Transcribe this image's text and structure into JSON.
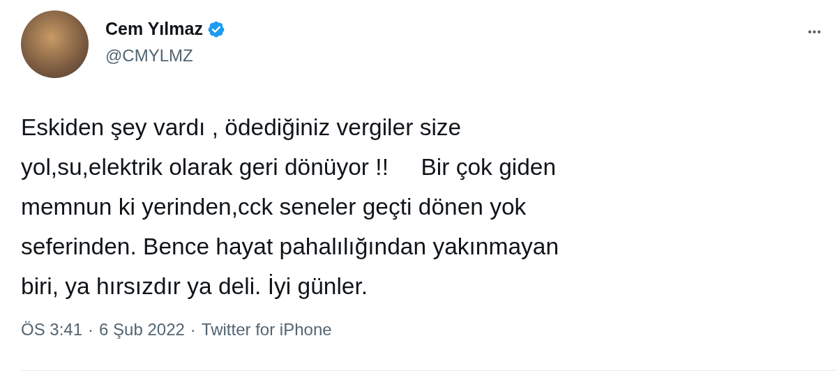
{
  "author": {
    "name": "Cem Yılmaz",
    "verified": true,
    "handle": "@CMYLMZ"
  },
  "more_button": {
    "label": "•••"
  },
  "tweet": {
    "text": "Eskiden şey vardı , ödediğiniz vergiler size\nyol,su,elektrik olarak geri dönüyor !!     Bir çok giden\nmemnun ki yerinden,cck seneler geçti dönen yok\nseferinden. Bence hayat pahalılığından yakınmayan\nbiri, ya hırsızdır ya deli. İyi günler."
  },
  "meta": {
    "time": "ÖS 3:41",
    "separator": "·",
    "date": "6 Şub 2022",
    "source": "Twitter for iPhone"
  }
}
